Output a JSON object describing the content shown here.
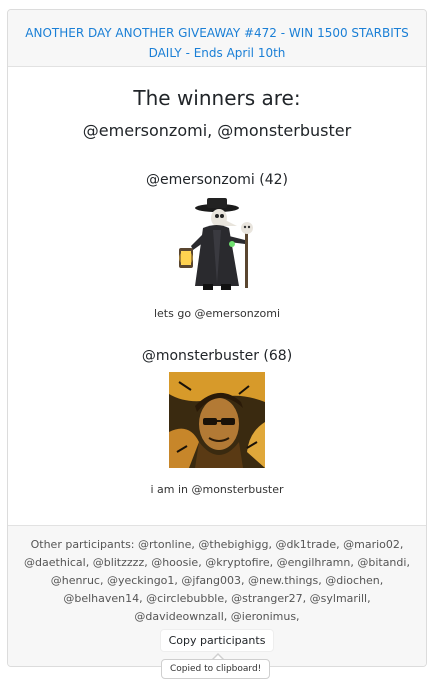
{
  "header": {
    "giveaway_link": "ANOTHER DAY ANOTHER GIVEAWAY #472 - WIN 1500 STARBITS DAILY - Ends April 10th"
  },
  "winners": {
    "title": "The winners are:",
    "names": "@emersonzomi, @monsterbuster",
    "entries": [
      {
        "name": "@emersonzomi (42)",
        "comment": "lets go @emersonzomi"
      },
      {
        "name": "@monsterbuster (68)",
        "comment": "i am in @monsterbuster"
      }
    ]
  },
  "footer": {
    "participants": "Other participants: @rtonline, @thebighigg, @dk1trade, @mario02, @daethical, @blitzzzz, @hoosie, @kryptofire, @engilhramn, @bitandi, @henruc, @yeckingo1, @jfang003, @new.things, @diochen, @belhaven14, @circlebubble, @stranger27, @sylmarill, @davideownzall, @ieronimus,",
    "copy_button": "Copy participants",
    "tooltip": "Copied to clipboard!"
  },
  "colors": {
    "link": "#1a7fd6",
    "header_bg": "#f7f7f7"
  }
}
